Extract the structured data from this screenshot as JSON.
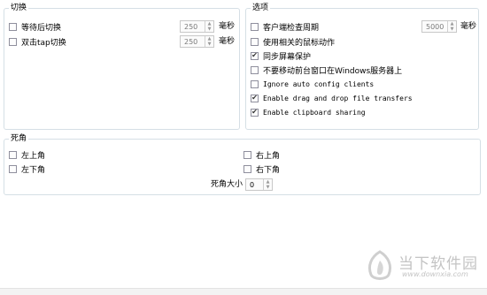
{
  "switching": {
    "title": "切换",
    "items": [
      {
        "label": "等待后切换",
        "checked": false,
        "value": "250",
        "unit": "毫秒"
      },
      {
        "label": "双击tap切换",
        "checked": false,
        "value": "250",
        "unit": "毫秒"
      }
    ]
  },
  "options": {
    "title": "选项",
    "interval": {
      "label": "客户端检查周期",
      "checked": false,
      "value": "5000",
      "unit": "毫秒"
    },
    "items": [
      {
        "label": "使用相关的鼠标动作",
        "checked": false
      },
      {
        "label": "同步屏幕保护",
        "checked": true
      },
      {
        "label": "不要移动前台窗口在Windows服务器上",
        "checked": false
      },
      {
        "label": "Ignore auto config clients",
        "checked": false
      },
      {
        "label": "Enable drag and drop file transfers",
        "checked": true
      },
      {
        "label": "Enable clipboard sharing",
        "checked": true
      }
    ]
  },
  "corners": {
    "title": "死角",
    "top_left": "左上角",
    "top_right": "右上角",
    "bottom_left": "左下角",
    "bottom_right": "右下角",
    "size_label": "死角大小",
    "size_value": "0"
  },
  "watermark": {
    "brand": "当下软件园",
    "url": "www.downxia.com"
  },
  "icons": {
    "check": "checkmark-icon",
    "spin_up": "spin-up-icon",
    "spin_down": "spin-down-icon",
    "logo": "downxia-logo-icon"
  },
  "colors": {
    "border": "#d5dfe5",
    "watermark": "#c9c9c9"
  }
}
